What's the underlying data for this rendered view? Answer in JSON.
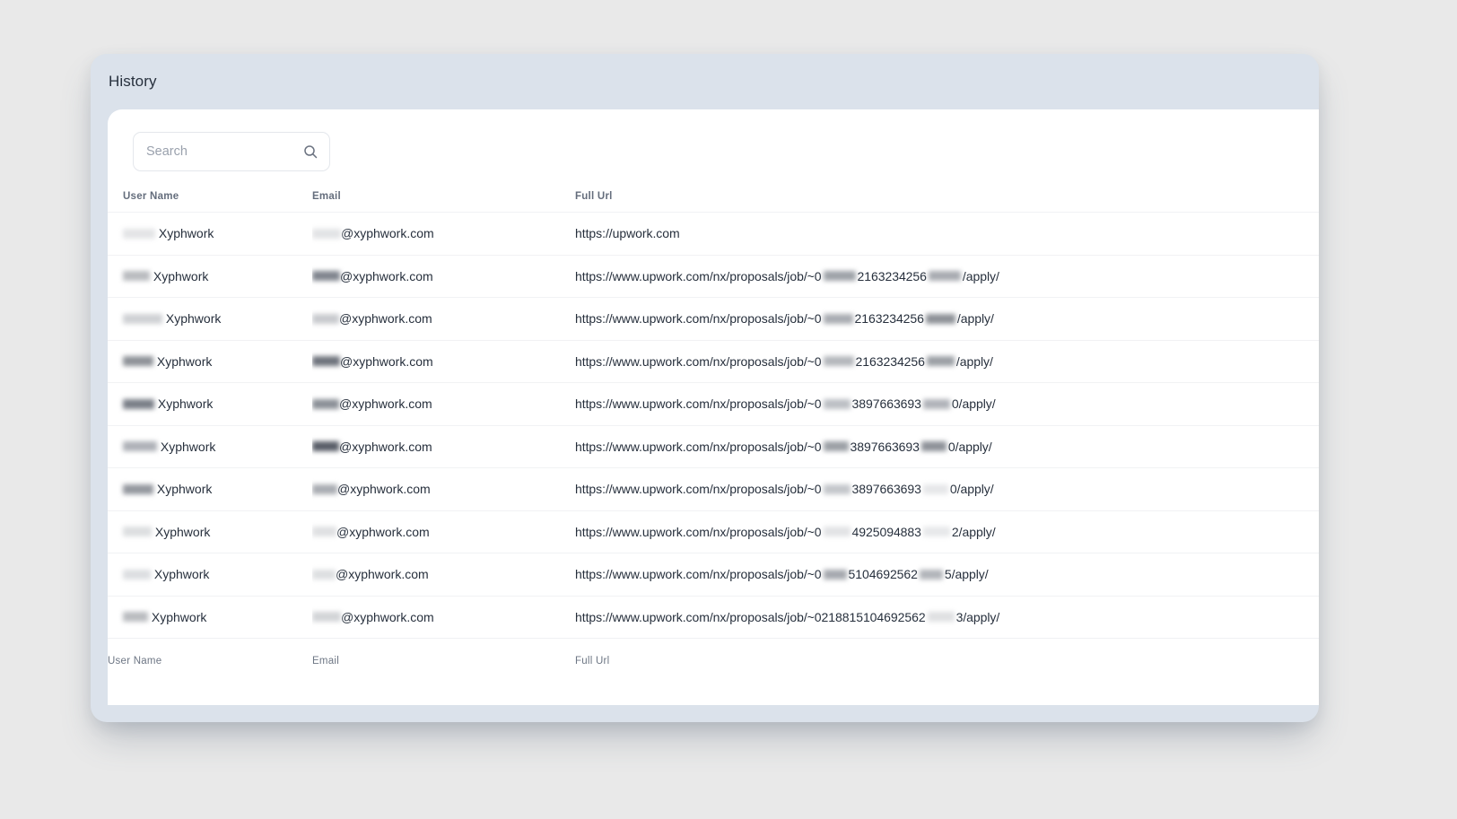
{
  "window": {
    "title": "History",
    "background_color": "#e9e9e9",
    "shell_color": "#dbe2eb",
    "panel_color": "#ffffff"
  },
  "search": {
    "placeholder": "Search",
    "value": "",
    "icon": "search-icon"
  },
  "table": {
    "columns": [
      "User Name",
      "Email",
      "Full Url"
    ],
    "footer_columns": [
      "User Name",
      "Email",
      "Full Url"
    ],
    "rows": [
      {
        "user_name_redacted_width": 36,
        "user_name_redacted_shade": "#e3e4e6",
        "user_name_suffix": "Xyphwork",
        "email_redacted_width": 32,
        "email_redacted_shade": "#e2e3e5",
        "email_suffix": "@xyphwork.com",
        "url_prefix": "https://upwork.com",
        "url_mid": "",
        "url_suffix": "",
        "url_has_redaction": false
      },
      {
        "user_name_redacted_width": 30,
        "user_name_redacted_shade": "#b9bbbf",
        "user_name_suffix": "Xyphwork",
        "email_redacted_width": 31,
        "email_redacted_shade": "#80858e",
        "email_suffix": "@xyphwork.com",
        "url_prefix": "https://www.upwork.com/nx/proposals/job/~0",
        "url_mid": "2163234256",
        "url_suffix": "/apply/",
        "url_has_redaction": true,
        "url_gap1": 36,
        "url_gap1_shade": "#9ea2a8",
        "url_gap2": 36,
        "url_gap2_shade": "#a8abb1"
      },
      {
        "user_name_redacted_width": 44,
        "user_name_redacted_shade": "#cfd1d4",
        "user_name_suffix": "Xyphwork",
        "email_redacted_width": 30,
        "email_redacted_shade": "#c8cace",
        "email_suffix": "@xyphwork.com",
        "url_prefix": "https://www.upwork.com/nx/proposals/job/~0",
        "url_mid": "2163234256",
        "url_suffix": "/apply/",
        "url_has_redaction": true,
        "url_gap1": 33,
        "url_gap1_shade": "#a9acb2",
        "url_gap2": 33,
        "url_gap2_shade": "#8d9197"
      },
      {
        "user_name_redacted_width": 34,
        "user_name_redacted_shade": "#8e9298",
        "user_name_suffix": "Xyphwork",
        "email_redacted_width": 31,
        "email_redacted_shade": "#6e737c",
        "email_suffix": "@xyphwork.com",
        "url_prefix": "https://www.upwork.com/nx/proposals/job/~0",
        "url_mid": "2163234256",
        "url_suffix": "/apply/",
        "url_has_redaction": true,
        "url_gap1": 34,
        "url_gap1_shade": "#b4b7bc",
        "url_gap2": 31,
        "url_gap2_shade": "#9b9fa5"
      },
      {
        "user_name_redacted_width": 35,
        "user_name_redacted_shade": "#797e87",
        "user_name_suffix": "Xyphwork",
        "email_redacted_width": 30,
        "email_redacted_shade": "#8b9097",
        "email_suffix": "@xyphwork.com",
        "url_prefix": "https://www.upwork.com/nx/proposals/job/~0",
        "url_mid": "3897663693",
        "url_suffix": "0/apply/",
        "url_has_redaction": true,
        "url_gap1": 30,
        "url_gap1_shade": "#bcbfc4",
        "url_gap2": 30,
        "url_gap2_shade": "#b0b3b9"
      },
      {
        "user_name_redacted_width": 38,
        "user_name_redacted_shade": "#aeb1b7",
        "user_name_suffix": "Xyphwork",
        "email_redacted_width": 30,
        "email_redacted_shade": "#585d67",
        "email_suffix": "@xyphwork.com",
        "url_prefix": "https://www.upwork.com/nx/proposals/job/~0",
        "url_mid": "3897663693",
        "url_suffix": "0/apply/",
        "url_has_redaction": true,
        "url_gap1": 28,
        "url_gap1_shade": "#9b9fa5",
        "url_gap2": 28,
        "url_gap2_shade": "#8d9198"
      },
      {
        "user_name_redacted_width": 34,
        "user_name_redacted_shade": "#93979e",
        "user_name_suffix": "Xyphwork",
        "email_redacted_width": 28,
        "email_redacted_shade": "#a9acb2",
        "email_suffix": "@xyphwork.com",
        "url_prefix": "https://www.upwork.com/nx/proposals/job/~0",
        "url_mid": "3897663693",
        "url_suffix": "0/apply/",
        "url_has_redaction": true,
        "url_gap1": 30,
        "url_gap1_shade": "#c3c6ca",
        "url_gap2": 28,
        "url_gap2_shade": "#e6e7e9"
      },
      {
        "user_name_redacted_width": 32,
        "user_name_redacted_shade": "#dcdee0",
        "user_name_suffix": "Xyphwork",
        "email_redacted_width": 27,
        "email_redacted_shade": "#dfe0e2",
        "email_suffix": "@xyphwork.com",
        "url_prefix": "https://www.upwork.com/nx/proposals/job/~0",
        "url_mid": "4925094883",
        "url_suffix": "2/apply/",
        "url_has_redaction": true,
        "url_gap1": 30,
        "url_gap1_shade": "#e2e3e5",
        "url_gap2": 30,
        "url_gap2_shade": "#e7e8ea"
      },
      {
        "user_name_redacted_width": 31,
        "user_name_redacted_shade": "#dcdee1",
        "user_name_suffix": "Xyphwork",
        "email_redacted_width": 26,
        "email_redacted_shade": "#dddfe1",
        "email_suffix": "@xyphwork.com",
        "url_prefix": "https://www.upwork.com/nx/proposals/job/~0",
        "url_mid": "5104692562",
        "url_suffix": "5/apply/",
        "url_has_redaction": true,
        "url_gap1": 26,
        "url_gap1_shade": "#a5a8ae",
        "url_gap2": 26,
        "url_gap2_shade": "#b1b4b9"
      },
      {
        "user_name_redacted_width": 28,
        "user_name_redacted_shade": "#b9bbbf",
        "user_name_suffix": "Xyphwork",
        "email_redacted_width": 32,
        "email_redacted_shade": "#d2d4d7",
        "email_suffix": "@xyphwork.com",
        "url_prefix": "https://www.upwork.com/nx/proposals/job/~0218815104692562",
        "url_mid": "",
        "url_suffix": "3/apply/",
        "url_has_redaction": true,
        "url_gap1": 0,
        "url_gap1_shade": "#ffffff",
        "url_gap2": 30,
        "url_gap2_shade": "#dfe0e2"
      }
    ]
  }
}
